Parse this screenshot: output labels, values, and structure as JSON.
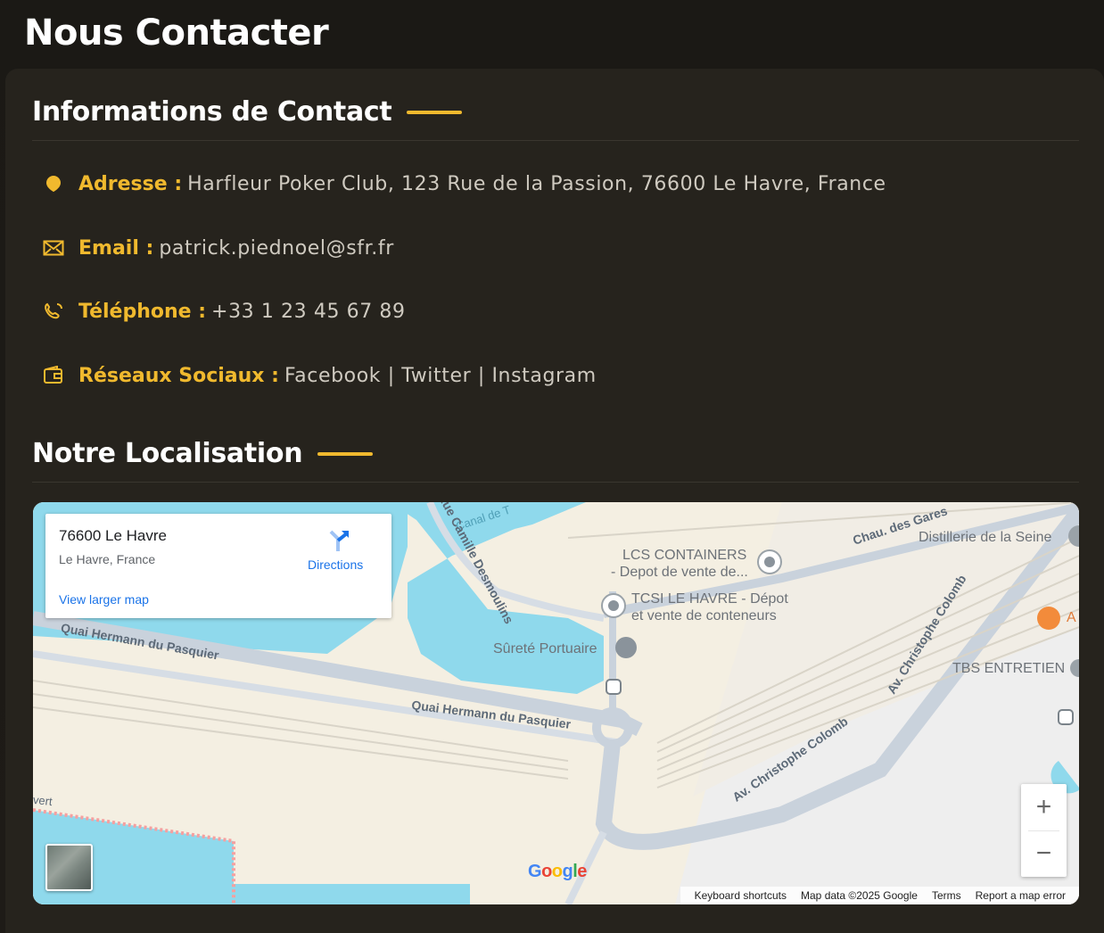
{
  "page": {
    "title": "Nous Contacter"
  },
  "contact": {
    "heading": "Informations de Contact",
    "items": [
      {
        "icon": "map-pin-icon",
        "label": "Adresse :",
        "value": "Harfleur Poker Club, 123 Rue de la Passion, 76600 Le Havre, France"
      },
      {
        "icon": "envelope-icon",
        "label": "Email :",
        "value": "patrick.piednoel@sfr.fr"
      },
      {
        "icon": "phone-icon",
        "label": "Téléphone :",
        "value": "+33 1 23 45 67 89"
      },
      {
        "icon": "wallet-icon",
        "label": "Réseaux Sociaux :",
        "value": "Facebook | Twitter | Instagram"
      }
    ]
  },
  "location": {
    "heading": "Notre Localisation"
  },
  "map": {
    "card": {
      "place": "76600 Le Havre",
      "subtitle": "Le Havre, France",
      "larger_map": "View larger map",
      "directions": "Directions"
    },
    "labels": {
      "canal": "Canal de T",
      "rue_camille": "Rue Camille Desmoulins",
      "quai_top": "Quai Hermann du Pasquier",
      "quai_mid": "Quai Hermann du Pasquier",
      "lcs1": "LCS CONTAINERS",
      "lcs2": "- Depot de vente de...",
      "tcsi1": "TCSI LE HAVRE - Dépot",
      "tcsi2": "et vente de conteneurs",
      "surete": "Sûreté Portuaire",
      "chau": "Chau. des Gares",
      "distillerie": "Distillerie de la Seine",
      "av_colomb_1": "Av. Christophe Colomb",
      "av_colomb_2": "Av. Christophe Colomb",
      "tbs": "TBS ENTRETIEN",
      "a_label": "A",
      "vert": "vert"
    },
    "zoom_in": "+",
    "zoom_out": "−",
    "google": "Google",
    "attribution": [
      "Keyboard shortcuts",
      "Map data ©2025 Google",
      "Terms",
      "Report a map error"
    ],
    "colors": {
      "water": "#8fd9ec",
      "land": "#f4efe2",
      "road": "#c9d2dc",
      "accent": "#f0b92e"
    }
  }
}
